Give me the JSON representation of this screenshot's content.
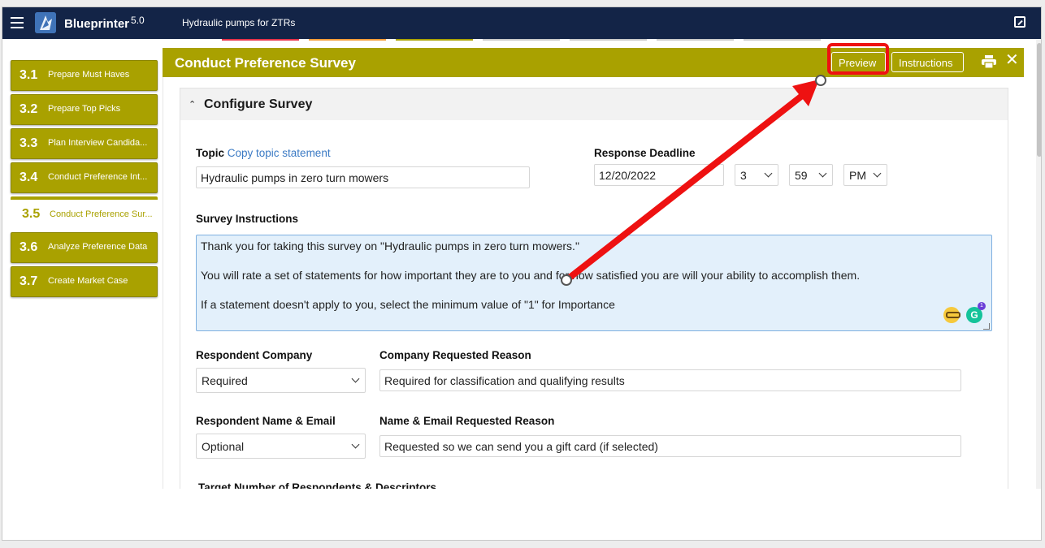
{
  "app": {
    "name": "Blueprinter",
    "version": "5.0",
    "document_title": "Hydraulic pumps for ZTRs"
  },
  "top_strips": [
    "#e4334a",
    "#f39c3a",
    "#a9a100",
    "#c9c9c9",
    "#c9c9c9",
    "#c9c9c9",
    "#c9c9c9"
  ],
  "sidebar": {
    "items": [
      {
        "num": "3.1",
        "label": "Prepare Must Haves",
        "active": false
      },
      {
        "num": "3.2",
        "label": "Prepare Top Picks",
        "active": false
      },
      {
        "num": "3.3",
        "label": "Plan Interview Candida...",
        "active": false
      },
      {
        "num": "3.4",
        "label": "Conduct Preference Int...",
        "active": false
      },
      {
        "num": "3.5",
        "label": "Conduct Preference Sur...",
        "active": true
      },
      {
        "num": "3.6",
        "label": "Analyze Preference Data",
        "active": false
      },
      {
        "num": "3.7",
        "label": "Create Market Case",
        "active": false
      }
    ]
  },
  "panel": {
    "title": "Conduct Preference Survey",
    "preview_label": "Preview",
    "instructions_label": "Instructions",
    "accent_color": "#a9a100"
  },
  "section": {
    "title": "Configure Survey"
  },
  "form": {
    "topic_label": "Topic",
    "topic_link": "Copy topic statement",
    "topic_value": "Hydraulic pumps in zero turn mowers",
    "deadline_label": "Response Deadline",
    "deadline_date": "12/20/2022",
    "deadline_hour": "3",
    "deadline_minute": "59",
    "deadline_ampm": "PM",
    "instructions_label": "Survey Instructions",
    "instructions_lines": [
      "Thank you for taking this survey on \"Hydraulic pumps in zero turn mowers.\"",
      "You will rate a set of statements for how important they are to you and for how satisfied you are will your ability to accomplish them.",
      "If a statement doesn't apply to you, select the minimum value of \"1\" for Importance"
    ],
    "grammarly_badge": "1",
    "grammarly_letter": "G",
    "respondent_company_label": "Respondent Company",
    "respondent_company_value": "Required",
    "company_reason_label": "Company Requested Reason",
    "company_reason_value": "Required for classification and qualifying results",
    "respondent_name_label": "Respondent Name & Email",
    "respondent_name_value": "Optional",
    "name_reason_label": "Name & Email Requested Reason",
    "name_reason_value": "Requested so we can send you a gift card (if selected)",
    "target_label": "Target Number of Respondents & Descriptors"
  },
  "annotation": {
    "highlight_color": "#ee1111",
    "arrow_color": "#ee1111"
  }
}
